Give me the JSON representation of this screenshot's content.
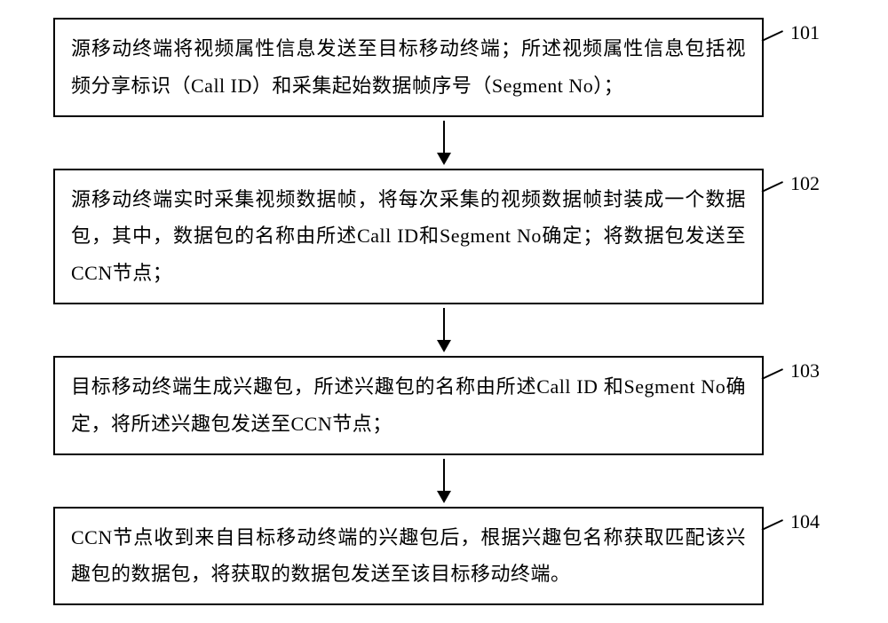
{
  "steps": [
    {
      "num": "101",
      "text": "源移动终端将视频属性信息发送至目标移动终端；所述视频属性信息包括视频分享标识（Call ID）和采集起始数据帧序号（Segment No）；"
    },
    {
      "num": "102",
      "text": "源移动终端实时采集视频数据帧，将每次采集的视频数据帧封装成一个数据包，其中，数据包的名称由所述Call ID和Segment No确定；将数据包发送至CCN节点；"
    },
    {
      "num": "103",
      "text": "目标移动终端生成兴趣包，所述兴趣包的名称由所述Call ID 和Segment No确定，将所述兴趣包发送至CCN节点；"
    },
    {
      "num": "104",
      "text": "CCN节点收到来自目标移动终端的兴趣包后，根据兴趣包名称获取匹配该兴趣包的数据包，将获取的数据包发送至该目标移动终端。"
    }
  ]
}
